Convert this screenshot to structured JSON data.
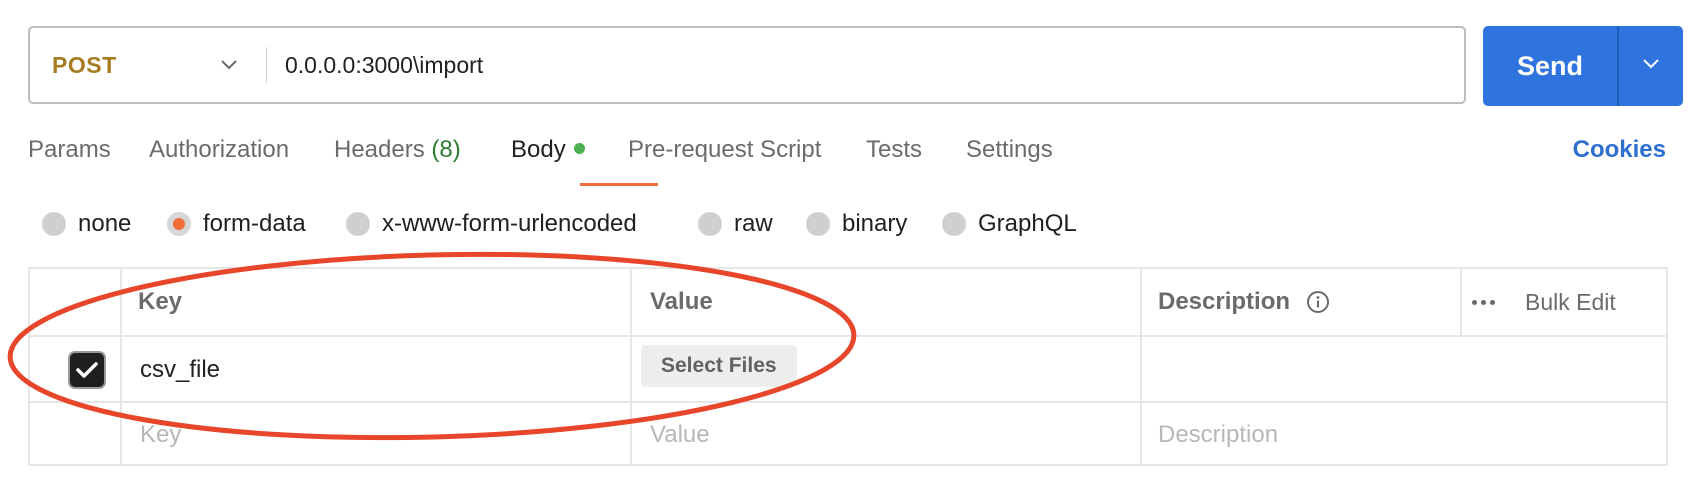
{
  "request": {
    "method": "POST",
    "url": "0.0.0.0:3000\\import",
    "send_label": "Send"
  },
  "tabs": {
    "params": "Params",
    "authorization": "Authorization",
    "headers": "Headers",
    "headers_count": "(8)",
    "body": "Body",
    "prerequest": "Pre-request Script",
    "tests": "Tests",
    "settings": "Settings",
    "cookies": "Cookies"
  },
  "body_types": {
    "none": "none",
    "form_data": "form-data",
    "urlencoded": "x-www-form-urlencoded",
    "raw": "raw",
    "binary": "binary",
    "graphql": "GraphQL",
    "selected": "form-data"
  },
  "table": {
    "headers": {
      "key": "Key",
      "value": "Value",
      "description": "Description",
      "bulk_edit": "Bulk Edit"
    },
    "rows": [
      {
        "key": "csv_file",
        "value_button": "Select Files",
        "description": ""
      }
    ],
    "placeholders": {
      "key": "Key",
      "value": "Value",
      "description": "Description"
    }
  },
  "colors": {
    "method": "#a57c22",
    "send": "#2f73df",
    "active_underline": "#f26b3a",
    "annotation": "#e8462a",
    "cookies": "#2f6fd0"
  }
}
